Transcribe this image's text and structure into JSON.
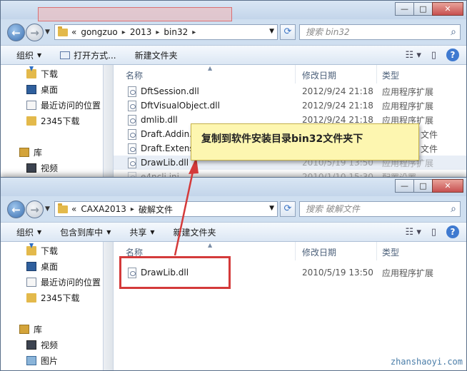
{
  "window_top": {
    "address": {
      "crumb_root": "«",
      "crumbs": [
        "gongzuo",
        "2013",
        "bin32"
      ]
    },
    "search_placeholder": "搜索 bin32",
    "toolbar": [
      "组织",
      "打开方式...",
      "新建文件夹"
    ],
    "nav": [
      "下载",
      "桌面",
      "最近访问的位置",
      "2345下载",
      "库",
      "视频"
    ],
    "columns": [
      "名称",
      "修改日期",
      "类型"
    ],
    "files": [
      {
        "name": "DftSession.dll",
        "date": "2012/9/24 21:18",
        "type": "应用程序扩展"
      },
      {
        "name": "DftVisualObject.dll",
        "date": "2012/9/24 21:18",
        "type": "应用程序扩展"
      },
      {
        "name": "dmlib.dll",
        "date": "2012/9/24 21:18",
        "type": "应用程序扩展"
      },
      {
        "name": "Draft.Addin.m",
        "date": "",
        "type": "文件"
      },
      {
        "name": "Draft.Extensio",
        "date": "",
        "type": "文件"
      },
      {
        "name": "DrawLib.dll",
        "date": "2010/5/19 13:50",
        "type": "应用程序扩展"
      },
      {
        "name": "e4ncli.ini",
        "date": "2010/1/10 15:30",
        "type": "配置设置"
      }
    ]
  },
  "window_bottom": {
    "address": {
      "crumb_root": "«",
      "crumbs": [
        "CAXA2013",
        "破解文件"
      ]
    },
    "search_placeholder": "搜索 破解文件",
    "toolbar": [
      "组织",
      "包含到库中",
      "共享",
      "新建文件夹"
    ],
    "nav": [
      "下载",
      "桌面",
      "最近访问的位置",
      "2345下载",
      "库",
      "视频",
      "图片"
    ],
    "columns": [
      "名称",
      "修改日期",
      "类型"
    ],
    "files": [
      {
        "name": "DrawLib.dll",
        "date": "2010/5/19 13:50",
        "type": "应用程序扩展"
      }
    ]
  },
  "callout_text": "复制到软件安装目录bin32文件夹下",
  "watermark": "zhanshaoyi.com",
  "colors": {
    "highlight_red": "#d43a3a",
    "callout_bg": "#fdf6b0"
  }
}
